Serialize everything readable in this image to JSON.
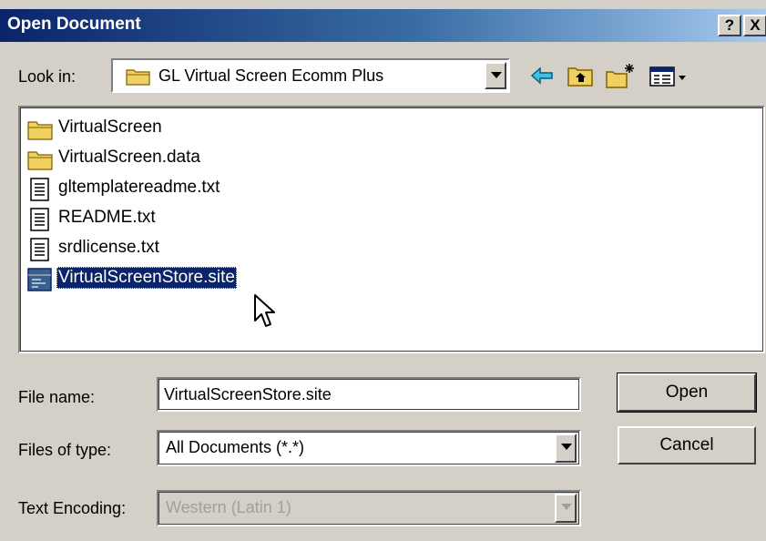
{
  "window": {
    "title": "Open Document",
    "help_label": "?",
    "close_label": "X"
  },
  "lookin": {
    "label": "Look in:",
    "value": "GL Virtual Screen Ecomm Plus",
    "icon": "folder-icon"
  },
  "toolbar": {
    "icons": [
      "back-arrow-icon",
      "up-one-level-icon",
      "new-folder-icon",
      "view-menu-icon"
    ]
  },
  "files": [
    {
      "name": "VirtualScreen",
      "icon": "folder-icon",
      "selected": false
    },
    {
      "name": "VirtualScreen.data",
      "icon": "folder-icon",
      "selected": false
    },
    {
      "name": "gltemplatereadme.txt",
      "icon": "text-file-icon",
      "selected": false
    },
    {
      "name": "README.txt",
      "icon": "text-file-icon",
      "selected": false
    },
    {
      "name": "srdlicense.txt",
      "icon": "text-file-icon",
      "selected": false
    },
    {
      "name": "VirtualScreenStore.site",
      "icon": "site-file-icon",
      "selected": true
    }
  ],
  "form": {
    "filename_label": "File name:",
    "filename_value": "VirtualScreenStore.site",
    "filetype_label": "Files of type:",
    "filetype_value": "All Documents (*.*)",
    "encoding_label": "Text Encoding:",
    "encoding_value": "Western (Latin 1)"
  },
  "buttons": {
    "open": "Open",
    "cancel": "Cancel"
  },
  "colors": {
    "title_bar": "#0a246a",
    "selection": "#0a246a",
    "face": "#d4d0c8",
    "back_arrow": "#00a0c0"
  }
}
